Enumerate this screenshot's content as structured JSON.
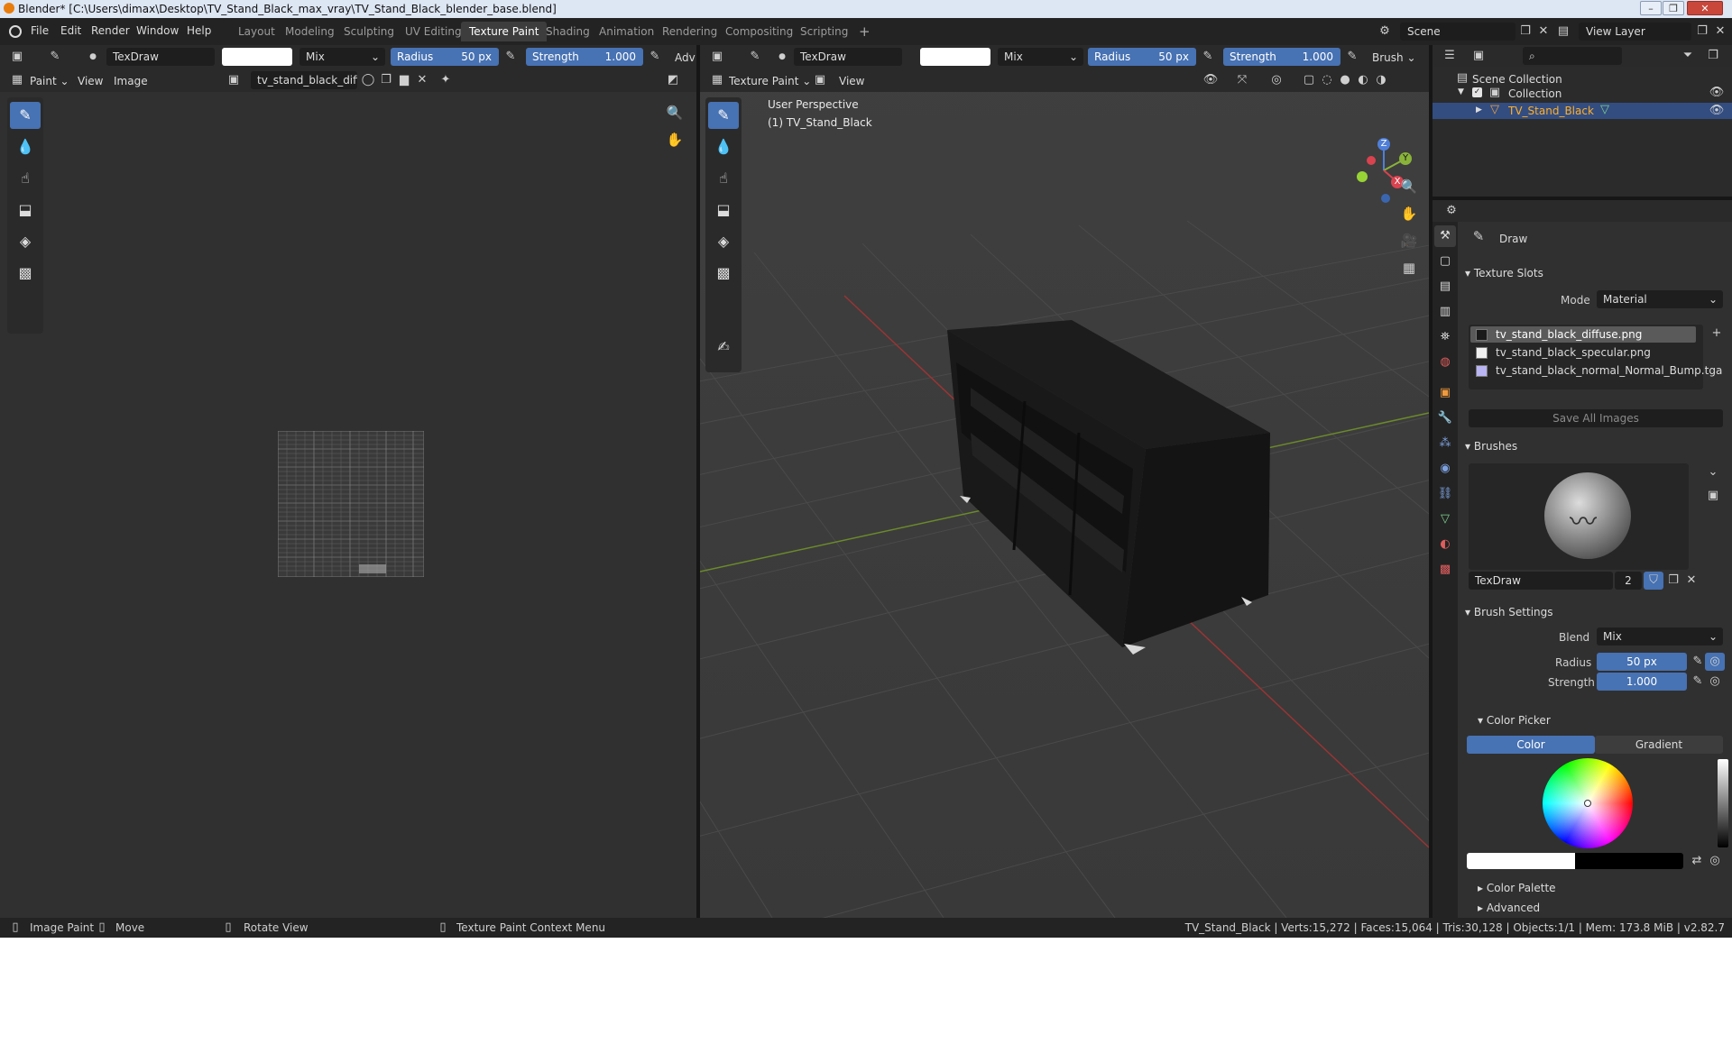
{
  "window": {
    "title": "Blender* [C:\\Users\\dimax\\Desktop\\TV_Stand_Black_max_vray\\TV_Stand_Black_blender_base.blend]",
    "min_icon": "minimize-icon",
    "max_icon": "maximize-icon",
    "close_icon": "close-icon"
  },
  "menu": {
    "items": [
      "File",
      "Edit",
      "Render",
      "Window",
      "Help"
    ],
    "workspaces": [
      "Layout",
      "Modeling",
      "Sculpting",
      "UV Editing",
      "Texture Paint",
      "Shading",
      "Animation",
      "Rendering",
      "Compositing",
      "Scripting"
    ],
    "active_workspace": "Texture Paint",
    "add_tab": "+",
    "scene_label": "Scene",
    "view_layer_label": "View Layer"
  },
  "image_editor": {
    "brush_name": "TexDraw",
    "blend": "Mix",
    "radius_label": "Radius",
    "radius_value": "50 px",
    "strength_label": "Strength",
    "strength_value": "1.000",
    "adv_label": "Adv",
    "mode": "Paint",
    "view_menu": "View",
    "image_menu": "Image",
    "image_name": "tv_stand_black_diffu..."
  },
  "viewport": {
    "brush_name": "TexDraw",
    "blend": "Mix",
    "radius_label": "Radius",
    "radius_value": "50 px",
    "strength_label": "Strength",
    "strength_value": "1.000",
    "brush_menu": "Brush",
    "mode": "Texture Paint",
    "view_menu": "View",
    "perspective": "User Perspective",
    "object_label": "(1) TV_Stand_Black",
    "gizmo": {
      "x": "X",
      "y": "Y",
      "z": "Z"
    }
  },
  "outliner": {
    "root": "Scene Collection",
    "collection": "Collection",
    "object": "TV_Stand_Black"
  },
  "properties": {
    "tool_name": "Draw",
    "texture_slots": {
      "title": "Texture Slots",
      "mode_label": "Mode",
      "mode_value": "Material",
      "slots": [
        {
          "name": "tv_stand_black_diffuse.png",
          "swatch": "#1a1a1a"
        },
        {
          "name": "tv_stand_black_specular.png",
          "swatch": "#f0f0f0"
        },
        {
          "name": "tv_stand_black_normal_Normal_Bump.tga",
          "swatch": "#b9b4f2"
        }
      ],
      "save_all": "Save All Images"
    },
    "brushes": {
      "title": "Brushes",
      "brush_name": "TexDraw",
      "users": "2"
    },
    "brush_settings": {
      "title": "Brush Settings",
      "blend_label": "Blend",
      "blend_value": "Mix",
      "radius_label": "Radius",
      "radius_value": "50 px",
      "strength_label": "Strength",
      "strength_value": "1.000"
    },
    "color_picker": {
      "title": "Color Picker",
      "tab_color": "Color",
      "tab_gradient": "Gradient"
    },
    "color_palette": "Color Palette",
    "advanced": "Advanced"
  },
  "status": {
    "left_1": "Image Paint",
    "left_2": "Move",
    "left_3": "Rotate View",
    "left_4": "Texture Paint Context Menu",
    "right": "TV_Stand_Black | Verts:15,272 | Faces:15,064 | Tris:30,128 | Objects:1/1 | Mem: 173.8 MiB | v2.82.7"
  },
  "colors": {
    "accent": "#4772b3",
    "header_bg": "#2a2a2a",
    "panel_bg": "#303030",
    "menu_bg": "#232323"
  }
}
